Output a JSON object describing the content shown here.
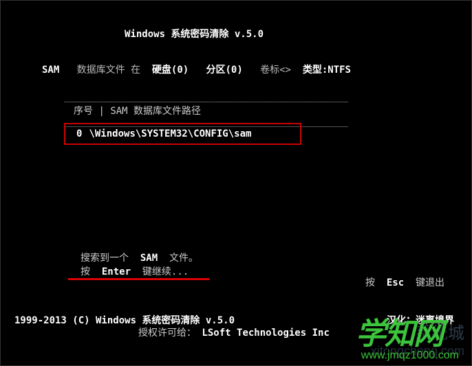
{
  "title": "Windows 系统密码清除 v.5.0",
  "header": {
    "sam_label": "SAM",
    "db_file_label": "数据库文件 在",
    "disk_label": "硬盘(0)",
    "partition_label": "分区(0)",
    "volume_label": "卷标<>",
    "type_label": "类型:NTFS"
  },
  "separator": "_________________________________________________",
  "columns": {
    "index_label": "序号",
    "sep": "|",
    "path_label": "SAM 数据库文件路径"
  },
  "rows": [
    {
      "index": "0",
      "path": "\\Windows\\SYSTEM32\\CONFIG\\sam"
    }
  ],
  "search": {
    "line1_pre": "搜索到一个",
    "line1_bold": "SAM",
    "line1_post": "文件。",
    "line2_pre": "按",
    "line2_bold": "Enter",
    "line2_post": "键继续..."
  },
  "esc": {
    "pre": "按",
    "key": "Esc",
    "post": "键退出"
  },
  "footer": {
    "copyright": "1999-2013 (C) Windows 系统密码清除 v.5.0",
    "translator": "汉化：迷离境界",
    "license_pre": "授权许可给：",
    "license_name": "LSoft Technologies Inc"
  },
  "watermark": {
    "main": "学知网",
    "url": "www.jmqz1000.com",
    "bg_text": "系统城",
    "bg_url": "xitongcheng.com"
  }
}
